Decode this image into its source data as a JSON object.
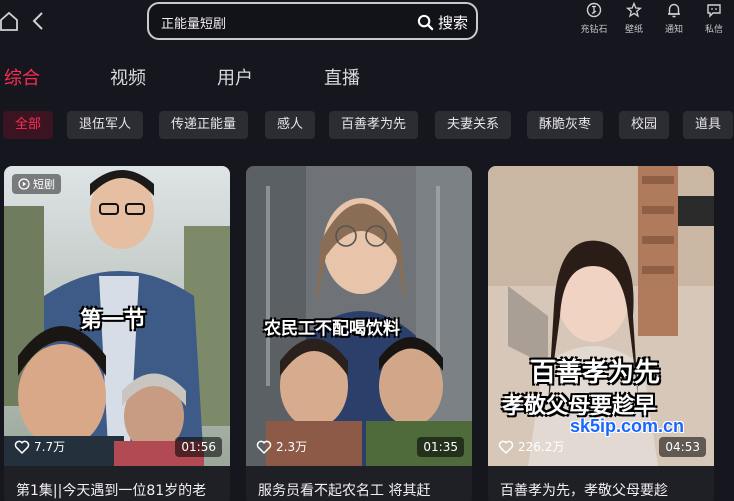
{
  "topbar": {
    "search_value": "正能量短剧",
    "search_button_label": "搜索",
    "icons": [
      {
        "name": "recharge",
        "label": "充钻石"
      },
      {
        "name": "wallpaper",
        "label": "壁纸"
      },
      {
        "name": "notification",
        "label": "通知"
      },
      {
        "name": "message",
        "label": "私信"
      }
    ]
  },
  "tabs": [
    {
      "label": "综合",
      "active": true
    },
    {
      "label": "视频",
      "active": false
    },
    {
      "label": "用户",
      "active": false
    },
    {
      "label": "直播",
      "active": false
    }
  ],
  "chips": [
    {
      "label": "全部",
      "active": true
    },
    {
      "label": "退伍军人"
    },
    {
      "label": "传递正能量"
    },
    {
      "label": "感人"
    },
    {
      "label": "百善孝为先"
    },
    {
      "label": "夫妻关系"
    },
    {
      "label": "酥脆灰枣"
    },
    {
      "label": "校园"
    },
    {
      "label": "道具"
    }
  ],
  "cards": [
    {
      "type_badge": "短剧",
      "overlay_text": "第一节",
      "likes": "7.7万",
      "duration": "01:56",
      "title": "第1集||今天遇到一位81岁的老"
    },
    {
      "overlay_text": "农民工不配喝饮料",
      "likes": "2.3万",
      "duration": "01:35",
      "title": "服务员看不起农名工 将其赶"
    },
    {
      "overlay_line1": "百善孝为先",
      "overlay_line2": "孝敬父母要趁早",
      "watermark": "sk5ip.com.cn",
      "likes": "226.2万",
      "duration": "04:53",
      "title": "百善孝为先，孝敬父母要趁"
    }
  ],
  "colors": {
    "accent": "#fe2c55",
    "background": "#16161e",
    "chip_bg": "#2c2c33"
  }
}
